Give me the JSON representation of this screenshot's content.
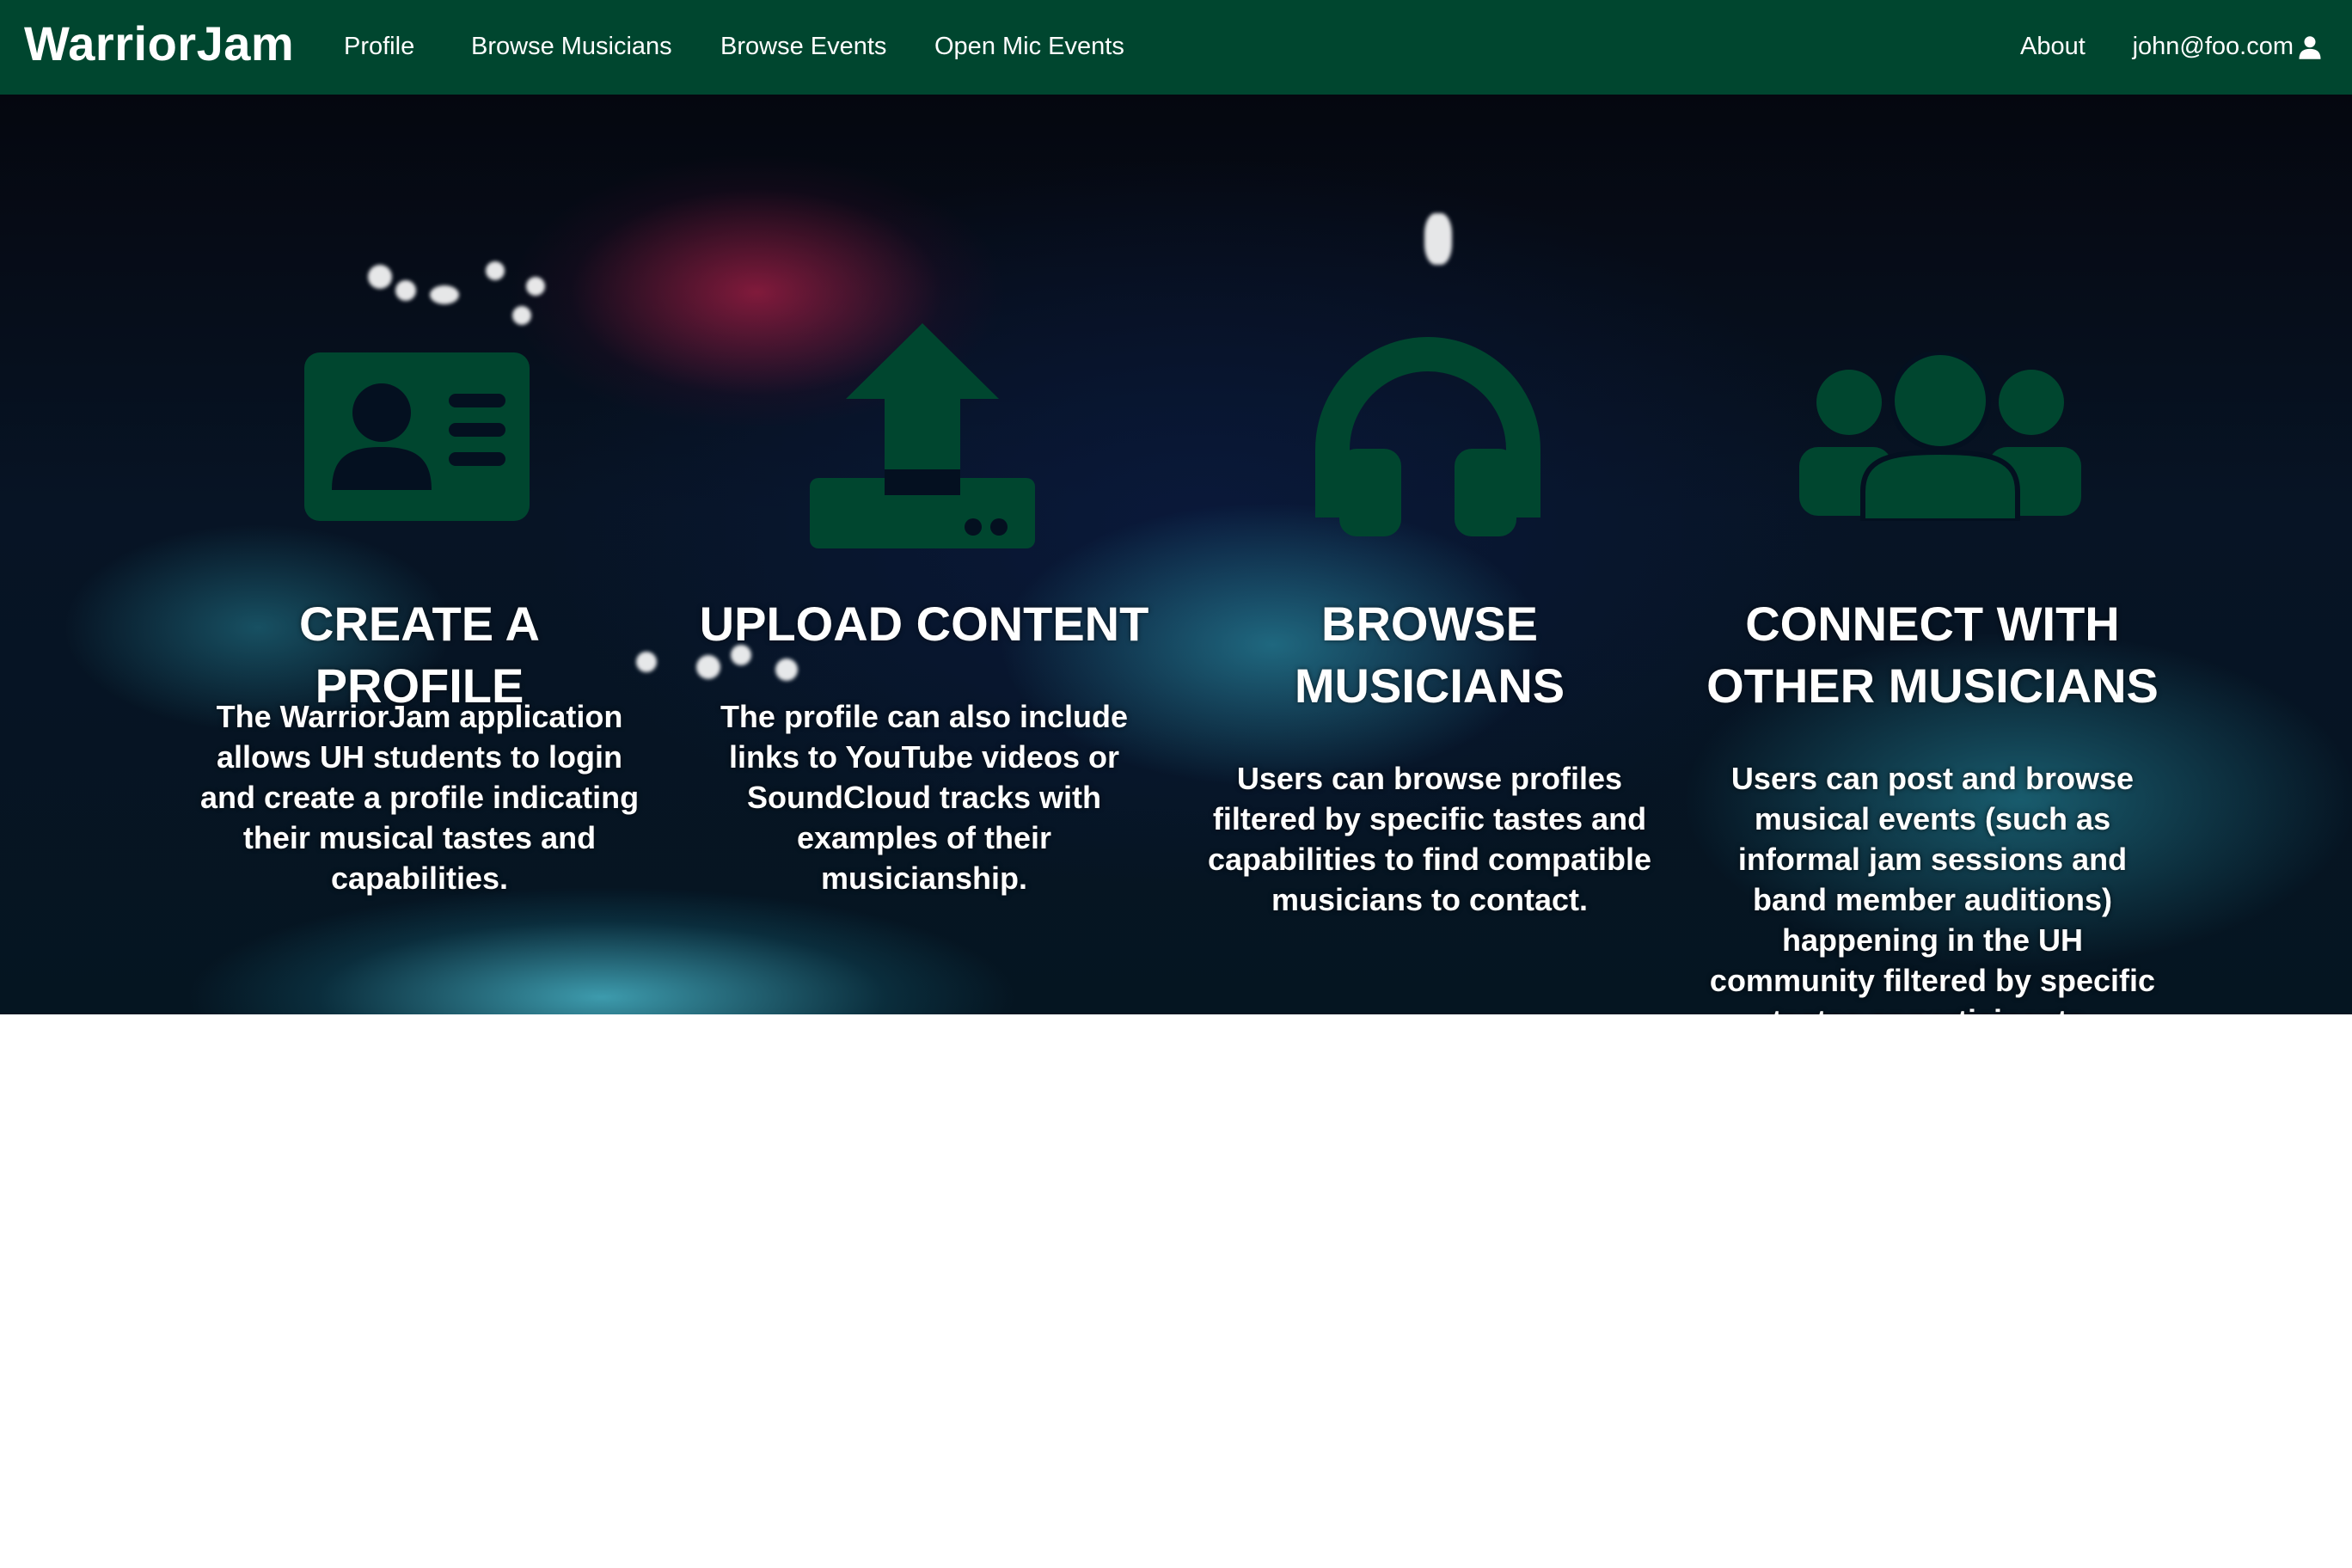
{
  "navbar": {
    "brand": "WarriorJam",
    "links": [
      "Profile",
      "Browse Musicians",
      "Browse Events",
      "Open Mic Events"
    ],
    "about": "About",
    "user": "john@foo.com",
    "user_icon": "user-icon"
  },
  "colors": {
    "brand_green": "#00462f",
    "icon_green": "#00462f",
    "text": "#ffffff"
  },
  "features": [
    {
      "icon": "id-card-icon",
      "title": "CREATE A PROFILE",
      "description": "The WarriorJam application allows UH students to login and create a profile indicating their musical tastes and capabilities."
    },
    {
      "icon": "upload-icon",
      "title": "UPLOAD CONTENT",
      "description": "The profile can also include links to YouTube videos or SoundCloud tracks with examples of their musicianship."
    },
    {
      "icon": "headphones-icon",
      "title": "BROWSE MUSICIANS",
      "description": "Users can browse profiles filtered by specific tastes and capabilities to find compatible musicians to contact."
    },
    {
      "icon": "users-icon",
      "title": "CONNECT WITH OTHER MUSICIANS",
      "description": "Users can post and browse musical events (such as informal jam sessions and band member auditions) happening in the UH community filtered by specific tastes or participants."
    }
  ]
}
